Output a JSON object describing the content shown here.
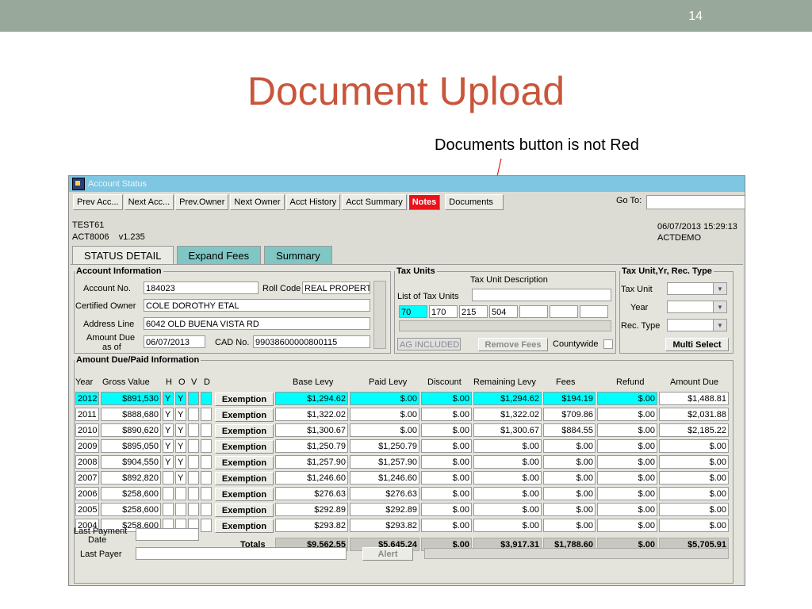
{
  "slide": {
    "number": "14",
    "title": "Document Upload",
    "callout": "Documents button is not Red"
  },
  "app": {
    "window_title": "Account Status",
    "toolbar": [
      {
        "label": "Prev Acc..."
      },
      {
        "label": "Next Acc..."
      },
      {
        "label": "Prev.Owner"
      },
      {
        "label": "Next Owner"
      },
      {
        "label": "Acct History"
      },
      {
        "label": "Acct Summary"
      },
      {
        "label": "Notes",
        "red": true
      },
      {
        "label": "Documents"
      }
    ],
    "goto_label": "Go To:",
    "info_left": [
      "TEST61",
      "ACT8006    v1.235"
    ],
    "info_right": [
      "06/07/2013 15:29:13",
      "ACTDEMO"
    ],
    "tabs": [
      "STATUS DETAIL",
      "Expand Fees",
      "Summary"
    ],
    "account": {
      "legend": "Account Information",
      "account_no_label": "Account No.",
      "account_no": "184023",
      "roll_code_label": "Roll Code",
      "roll_code": "REAL PROPERTY",
      "owner_label": "Certified Owner",
      "owner": "COLE DOROTHY ETAL",
      "address_label": "Address Line",
      "address": "6042 OLD BUENA VISTA RD",
      "amount_due_label_1": "Amount Due",
      "amount_due_label_2": "as of",
      "amount_due_date": "06/07/2013",
      "cad_label": "CAD No.",
      "cad_no": "99038600000800115"
    },
    "tax_units": {
      "legend": "Tax Units",
      "desc_label": "Tax Unit Description",
      "list_label": "List of Tax Units",
      "units": [
        "70",
        "170",
        "215",
        "504",
        "",
        "",
        ""
      ],
      "ag": "AG INCLUDED",
      "remove": "Remove Fees",
      "countywide": "Countywide"
    },
    "tax_unit_yr": {
      "legend": "Tax Unit,Yr, Rec. Type",
      "unit_label": "Tax Unit",
      "year_label": "Year",
      "rec_label": "Rec. Type",
      "multi": "Multi Select"
    },
    "amount": {
      "legend": "Amount Due/Paid Information",
      "headers": [
        "Year",
        "Gross Value",
        "H",
        "O",
        "V",
        "D",
        "Base Levy",
        "Paid Levy",
        "Discount",
        "Remaining Levy",
        "Fees",
        "Refund",
        "Amount Due"
      ],
      "exemption_label": "Exemption",
      "rows": [
        {
          "year": "2012",
          "gross": "$891,530",
          "h": "Y",
          "o": "Y",
          "v": "",
          "d": "",
          "base": "$1,294.62",
          "paid": "$.00",
          "disc": "$.00",
          "rem": "$1,294.62",
          "fees": "$194.19",
          "refund": "$.00",
          "due": "$1,488.81"
        },
        {
          "year": "2011",
          "gross": "$888,680",
          "h": "Y",
          "o": "Y",
          "v": "",
          "d": "",
          "base": "$1,322.02",
          "paid": "$.00",
          "disc": "$.00",
          "rem": "$1,322.02",
          "fees": "$709.86",
          "refund": "$.00",
          "due": "$2,031.88"
        },
        {
          "year": "2010",
          "gross": "$890,620",
          "h": "Y",
          "o": "Y",
          "v": "",
          "d": "",
          "base": "$1,300.67",
          "paid": "$.00",
          "disc": "$.00",
          "rem": "$1,300.67",
          "fees": "$884.55",
          "refund": "$.00",
          "due": "$2,185.22"
        },
        {
          "year": "2009",
          "gross": "$895,050",
          "h": "Y",
          "o": "Y",
          "v": "",
          "d": "",
          "base": "$1,250.79",
          "paid": "$1,250.79",
          "disc": "$.00",
          "rem": "$.00",
          "fees": "$.00",
          "refund": "$.00",
          "due": "$.00"
        },
        {
          "year": "2008",
          "gross": "$904,550",
          "h": "Y",
          "o": "Y",
          "v": "",
          "d": "",
          "base": "$1,257.90",
          "paid": "$1,257.90",
          "disc": "$.00",
          "rem": "$.00",
          "fees": "$.00",
          "refund": "$.00",
          "due": "$.00"
        },
        {
          "year": "2007",
          "gross": "$892,820",
          "h": "",
          "o": "Y",
          "v": "",
          "d": "",
          "base": "$1,246.60",
          "paid": "$1,246.60",
          "disc": "$.00",
          "rem": "$.00",
          "fees": "$.00",
          "refund": "$.00",
          "due": "$.00"
        },
        {
          "year": "2006",
          "gross": "$258,600",
          "h": "",
          "o": "",
          "v": "",
          "d": "",
          "base": "$276.63",
          "paid": "$276.63",
          "disc": "$.00",
          "rem": "$.00",
          "fees": "$.00",
          "refund": "$.00",
          "due": "$.00"
        },
        {
          "year": "2005",
          "gross": "$258,600",
          "h": "",
          "o": "",
          "v": "",
          "d": "",
          "base": "$292.89",
          "paid": "$292.89",
          "disc": "$.00",
          "rem": "$.00",
          "fees": "$.00",
          "refund": "$.00",
          "due": "$.00"
        },
        {
          "year": "2004",
          "gross": "$258,600",
          "h": "",
          "o": "",
          "v": "",
          "d": "",
          "base": "$293.82",
          "paid": "$293.82",
          "disc": "$.00",
          "rem": "$.00",
          "fees": "$.00",
          "refund": "$.00",
          "due": "$.00"
        }
      ],
      "totals_label": "Totals",
      "totals": {
        "base": "$9,562.55",
        "paid": "$5,645.24",
        "disc": "$.00",
        "rem": "$3,917.31",
        "fees": "$1,788.60",
        "refund": "$.00",
        "due": "$5,705.91"
      },
      "last_payment_label_1": "Last Payment",
      "last_payment_label_2": "Date",
      "last_payer_label": "Last Payer",
      "alert": "Alert"
    }
  }
}
